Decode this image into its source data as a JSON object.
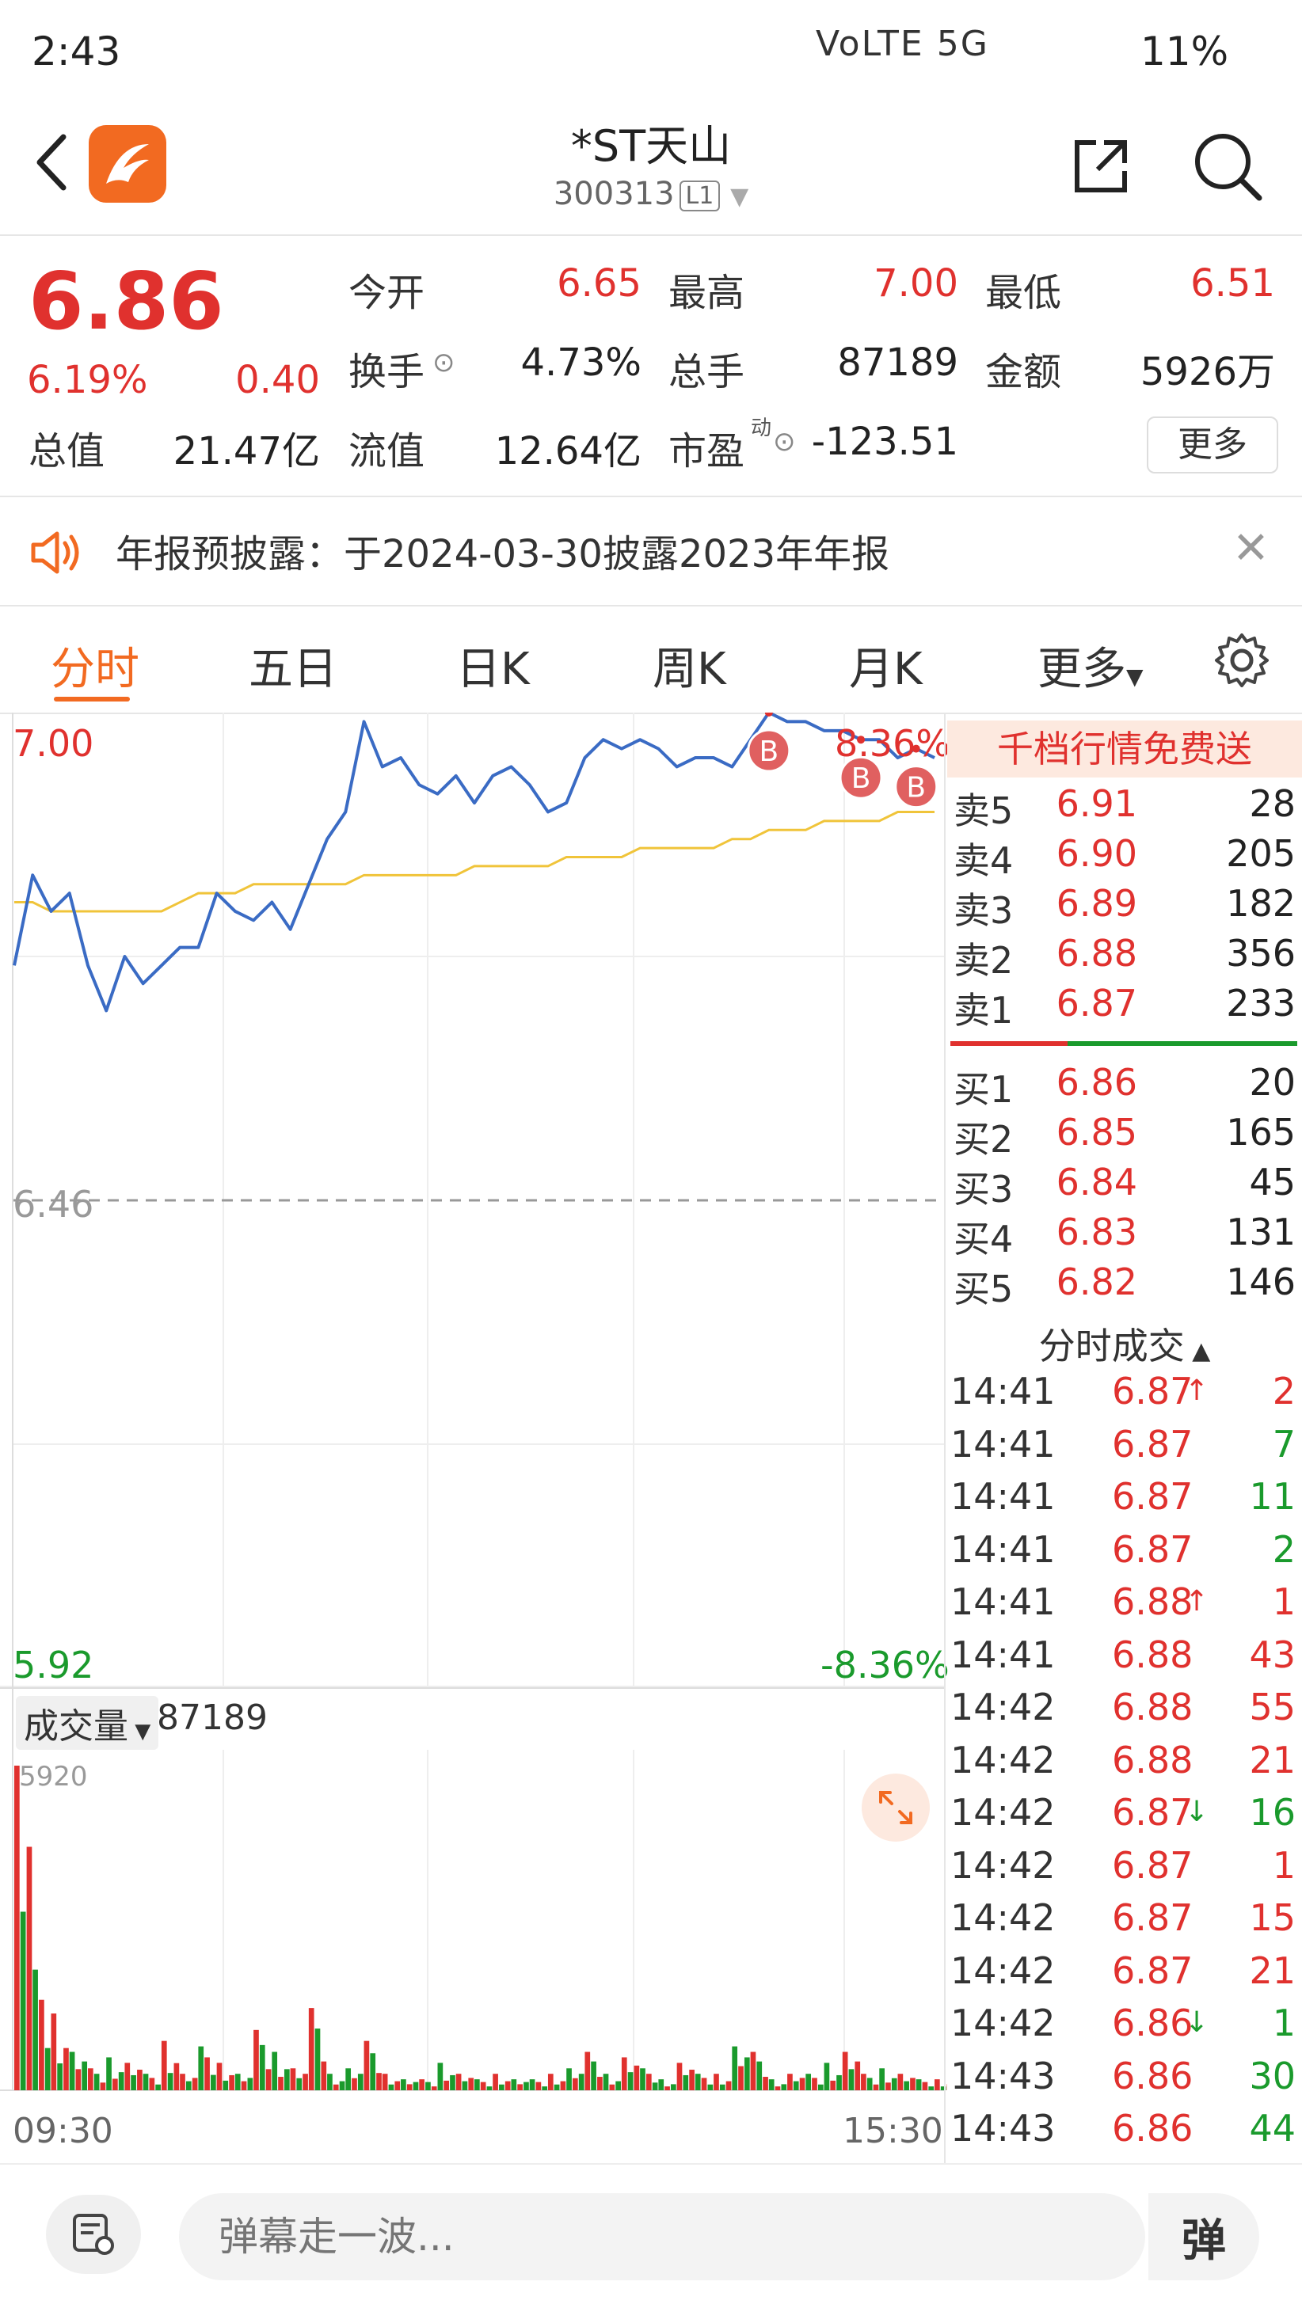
{
  "status_bar": {
    "time": "2:43",
    "icons": "VoLTE 5G",
    "battery": "11%"
  },
  "header": {
    "title": "*ST天山",
    "code": "300313",
    "level": "L1"
  },
  "quote": {
    "price": "6.86",
    "change_pct": "6.19%",
    "change_amt": "0.40",
    "stats": [
      {
        "label": "今开",
        "value": "6.65",
        "color": "red"
      },
      {
        "label": "最高",
        "value": "7.00",
        "color": "red"
      },
      {
        "label": "最低",
        "value": "6.51",
        "color": "red"
      },
      {
        "label": "换手",
        "value": "4.73%",
        "color": "default"
      },
      {
        "label": "总手",
        "value": "87189",
        "color": "default"
      },
      {
        "label": "金额",
        "value": "5926万",
        "color": "default"
      },
      {
        "label": "总值",
        "value": "21.47亿",
        "color": "default"
      },
      {
        "label": "流值",
        "value": "12.64亿",
        "color": "default"
      },
      {
        "label": "市盈",
        "value": "-123.51",
        "color": "default"
      }
    ],
    "pe_superscript": "动",
    "more_label": "更多"
  },
  "notice": {
    "text": "年报预披露：于2024-03-30披露2023年年报"
  },
  "tabs": [
    {
      "label": "分时",
      "active": true
    },
    {
      "label": "五日",
      "active": false
    },
    {
      "label": "日K",
      "active": false
    },
    {
      "label": "周K",
      "active": false
    },
    {
      "label": "月K",
      "active": false
    },
    {
      "label": "更多",
      "active": false
    }
  ],
  "chart_data": {
    "type": "line",
    "y_high": "7.00",
    "y_low": "5.92",
    "y_mid": "6.46",
    "pct_high": "8.36%",
    "pct_low": "-8.36%",
    "ylim": [
      5.92,
      7.0
    ],
    "prev_close": 6.46,
    "price_series": [
      6.72,
      6.82,
      6.78,
      6.8,
      6.72,
      6.67,
      6.73,
      6.7,
      6.72,
      6.74,
      6.74,
      6.8,
      6.78,
      6.77,
      6.79,
      6.76,
      6.81,
      6.86,
      6.89,
      6.99,
      6.94,
      6.95,
      6.92,
      6.91,
      6.93,
      6.9,
      6.93,
      6.94,
      6.92,
      6.89,
      6.9,
      6.95,
      6.97,
      6.96,
      6.97,
      6.96,
      6.94,
      6.95,
      6.95,
      6.94,
      6.97,
      7.0,
      6.99,
      6.99,
      6.98,
      6.98,
      6.97,
      6.97,
      6.95,
      6.96,
      6.95
    ],
    "avg_series": [
      6.79,
      6.79,
      6.78,
      6.78,
      6.78,
      6.78,
      6.78,
      6.78,
      6.78,
      6.79,
      6.8,
      6.8,
      6.8,
      6.81,
      6.81,
      6.81,
      6.81,
      6.81,
      6.81,
      6.82,
      6.82,
      6.82,
      6.82,
      6.82,
      6.82,
      6.83,
      6.83,
      6.83,
      6.83,
      6.83,
      6.84,
      6.84,
      6.84,
      6.84,
      6.85,
      6.85,
      6.85,
      6.85,
      6.85,
      6.86,
      6.86,
      6.87,
      6.87,
      6.87,
      6.88,
      6.88,
      6.88,
      6.88,
      6.89,
      6.89,
      6.89
    ],
    "trade_markers": [
      {
        "label": "B",
        "index": 41
      },
      {
        "label": "B",
        "index": 46
      },
      {
        "label": "B",
        "index": 49
      }
    ],
    "volume_label": "成交量",
    "volume_total": "87189",
    "volume_max_label": "5920",
    "volume_series": [
      5920,
      2200,
      1400,
      700,
      400,
      600,
      500,
      300,
      900,
      300,
      800,
      500,
      300,
      1100,
      700,
      400,
      1500,
      300,
      400,
      900,
      300,
      200,
      200,
      500,
      300,
      200,
      300,
      200,
      200,
      300,
      400,
      700,
      300,
      600,
      400,
      200,
      500,
      300,
      300,
      800,
      700,
      200,
      300,
      300,
      500,
      700,
      300,
      400,
      300,
      200,
      200
    ],
    "volume_up": [
      true,
      false,
      true,
      false,
      true,
      false,
      true,
      false,
      true,
      true,
      false,
      true,
      false,
      true,
      false,
      true,
      true,
      false,
      false,
      true,
      true,
      false,
      true,
      false,
      true,
      false,
      true,
      false,
      false,
      true,
      false,
      true,
      false,
      true,
      false,
      false,
      true,
      false,
      true,
      false,
      true,
      false,
      true,
      false,
      false,
      true,
      true,
      false,
      true,
      false,
      true
    ],
    "time_start": "09:30",
    "time_end": "15:30"
  },
  "orderbook": {
    "promo": "千档行情免费送",
    "asks": [
      {
        "label": "卖5",
        "price": "6.91",
        "volume": "28"
      },
      {
        "label": "卖4",
        "price": "6.90",
        "volume": "205"
      },
      {
        "label": "卖3",
        "price": "6.89",
        "volume": "182"
      },
      {
        "label": "卖2",
        "price": "6.88",
        "volume": "356"
      },
      {
        "label": "卖1",
        "price": "6.87",
        "volume": "233"
      }
    ],
    "bids": [
      {
        "label": "买1",
        "price": "6.86",
        "volume": "20"
      },
      {
        "label": "买2",
        "price": "6.85",
        "volume": "165"
      },
      {
        "label": "买3",
        "price": "6.84",
        "volume": "45"
      },
      {
        "label": "买4",
        "price": "6.83",
        "volume": "131"
      },
      {
        "label": "买5",
        "price": "6.82",
        "volume": "146"
      }
    ],
    "ticks_header": "分时成交",
    "ticks": [
      {
        "time": "14:41",
        "price": "6.87",
        "arrow": "↑",
        "volume": "2",
        "vol_color": "red"
      },
      {
        "time": "14:41",
        "price": "6.87",
        "arrow": "",
        "volume": "7",
        "vol_color": "green"
      },
      {
        "time": "14:41",
        "price": "6.87",
        "arrow": "",
        "volume": "11",
        "vol_color": "green"
      },
      {
        "time": "14:41",
        "price": "6.87",
        "arrow": "",
        "volume": "2",
        "vol_color": "green"
      },
      {
        "time": "14:41",
        "price": "6.88",
        "arrow": "↑",
        "volume": "1",
        "vol_color": "red"
      },
      {
        "time": "14:41",
        "price": "6.88",
        "arrow": "",
        "volume": "43",
        "vol_color": "red"
      },
      {
        "time": "14:42",
        "price": "6.88",
        "arrow": "",
        "volume": "55",
        "vol_color": "red"
      },
      {
        "time": "14:42",
        "price": "6.88",
        "arrow": "",
        "volume": "21",
        "vol_color": "red"
      },
      {
        "time": "14:42",
        "price": "6.87",
        "arrow": "↓",
        "volume": "16",
        "vol_color": "green"
      },
      {
        "time": "14:42",
        "price": "6.87",
        "arrow": "",
        "volume": "1",
        "vol_color": "red"
      },
      {
        "time": "14:42",
        "price": "6.87",
        "arrow": "",
        "volume": "15",
        "vol_color": "red"
      },
      {
        "time": "14:42",
        "price": "6.87",
        "arrow": "",
        "volume": "21",
        "vol_color": "red"
      },
      {
        "time": "14:42",
        "price": "6.86",
        "arrow": "↓",
        "volume": "1",
        "vol_color": "green"
      },
      {
        "time": "14:43",
        "price": "6.86",
        "arrow": "",
        "volume": "30",
        "vol_color": "green"
      },
      {
        "time": "14:43",
        "price": "6.86",
        "arrow": "",
        "volume": "44",
        "vol_color": "green"
      }
    ]
  },
  "bottom_bar": {
    "comment_placeholder": "弹幕走一波...",
    "danmu_label": "弹"
  },
  "colors": {
    "up": "#e0312e",
    "down": "#1a9a2c",
    "accent": "#f26a21",
    "price_line": "#3a6bc4",
    "avg_line": "#f0c43a"
  }
}
